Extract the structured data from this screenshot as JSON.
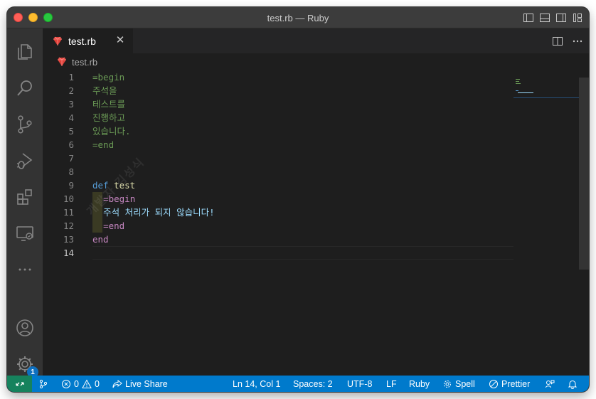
{
  "window": {
    "title": "test.rb — Ruby"
  },
  "tab": {
    "label": "test.rb",
    "close": "✕"
  },
  "breadcrumb": {
    "file": "test.rb"
  },
  "activity": {
    "settings_badge": "1"
  },
  "editor": {
    "current_line": 14,
    "line_numbers": [
      "1",
      "2",
      "3",
      "4",
      "5",
      "6",
      "7",
      "8",
      "9",
      "10",
      "11",
      "12",
      "13",
      "14"
    ],
    "lines": [
      {
        "indent": false,
        "tokens": [
          {
            "text": "=begin",
            "style": "comment"
          }
        ]
      },
      {
        "indent": false,
        "tokens": [
          {
            "text": "주석을",
            "style": "comment"
          }
        ]
      },
      {
        "indent": false,
        "tokens": [
          {
            "text": "테스트를",
            "style": "comment"
          }
        ]
      },
      {
        "indent": false,
        "tokens": [
          {
            "text": "진행하고",
            "style": "comment"
          }
        ]
      },
      {
        "indent": false,
        "tokens": [
          {
            "text": "있습니다.",
            "style": "comment"
          }
        ]
      },
      {
        "indent": false,
        "tokens": [
          {
            "text": "=end",
            "style": "comment"
          }
        ]
      },
      {
        "indent": false,
        "tokens": []
      },
      {
        "indent": false,
        "tokens": []
      },
      {
        "indent": false,
        "tokens": [
          {
            "text": "def",
            "style": "kw"
          },
          {
            "text": " ",
            "style": "plain"
          },
          {
            "text": "test",
            "style": "fn"
          }
        ]
      },
      {
        "indent": true,
        "tokens": [
          {
            "text": "  ",
            "style": "plain"
          },
          {
            "text": "=begin",
            "style": "kw2"
          }
        ]
      },
      {
        "indent": true,
        "tokens": [
          {
            "text": "  ",
            "style": "plain"
          },
          {
            "text": "주석 처리가 되지 않습니다!",
            "style": "str"
          }
        ]
      },
      {
        "indent": true,
        "tokens": [
          {
            "text": "  ",
            "style": "plain"
          },
          {
            "text": "=end",
            "style": "kw2"
          }
        ]
      },
      {
        "indent": false,
        "tokens": [
          {
            "text": "end",
            "style": "kw2"
          }
        ]
      },
      {
        "indent": false,
        "tokens": []
      }
    ],
    "watermark": "개발자 김성식"
  },
  "status": {
    "errors": "0",
    "warnings": "0",
    "live_share": "Live Share",
    "position": "Ln 14, Col 1",
    "spaces": "Spaces: 2",
    "encoding": "UTF-8",
    "eol": "LF",
    "language": "Ruby",
    "spell": "Spell",
    "prettier": "Prettier"
  },
  "colors": {
    "status_bar": "#007acc",
    "remote": "#16825d",
    "comment": "#6a9955",
    "keyword": "#569cd6",
    "keyword_control": "#c586c0",
    "function": "#dcdcaa",
    "string": "#9cdcfe"
  }
}
